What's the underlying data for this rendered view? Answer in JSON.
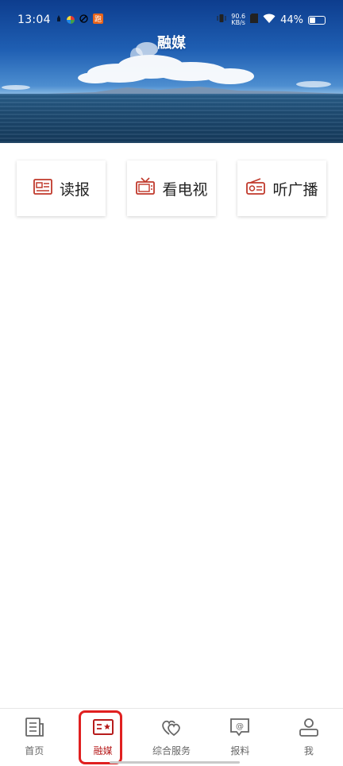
{
  "status_bar": {
    "time": "13:04",
    "net_speed_value": "90.6",
    "net_speed_unit": "KB/s",
    "battery": "44%",
    "battery_level": 0.44
  },
  "header": {
    "title": "融媒"
  },
  "cards": [
    {
      "label": "读报",
      "icon": "newspaper-icon"
    },
    {
      "label": "看电视",
      "icon": "tv-icon"
    },
    {
      "label": "听广播",
      "icon": "radio-icon"
    }
  ],
  "tabbar": {
    "active_index": 1,
    "items": [
      {
        "label": "首页",
        "icon": "news-home-icon"
      },
      {
        "label": "融媒",
        "icon": "media-card-icon"
      },
      {
        "label": "综合服务",
        "icon": "double-heart-icon"
      },
      {
        "label": "报料",
        "icon": "at-message-icon"
      },
      {
        "label": "我",
        "icon": "user-icon"
      }
    ]
  },
  "colors": {
    "accent": "#b71c1c",
    "highlight": "#e02020",
    "icon_red": "#c0392b"
  }
}
